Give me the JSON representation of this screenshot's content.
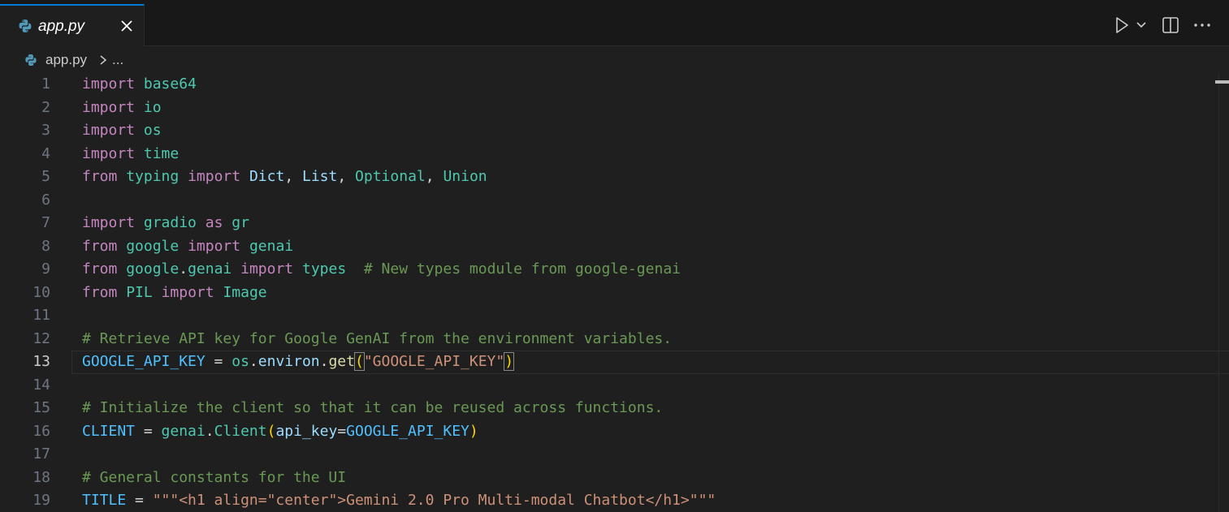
{
  "tab": {
    "label": "app.py",
    "icon": "python-icon"
  },
  "toolbar": {
    "run_icon": "run-icon",
    "run_dropdown_icon": "chevron-down-icon",
    "split_icon": "split-editor-icon",
    "more_icon": "ellipsis-icon"
  },
  "breadcrumb": {
    "file": "app.py",
    "more": "..."
  },
  "editor": {
    "current_line": 13,
    "lines": [
      {
        "n": "1"
      },
      {
        "n": "2"
      },
      {
        "n": "3"
      },
      {
        "n": "4"
      },
      {
        "n": "5"
      },
      {
        "n": "6"
      },
      {
        "n": "7"
      },
      {
        "n": "8"
      },
      {
        "n": "9"
      },
      {
        "n": "10"
      },
      {
        "n": "11"
      },
      {
        "n": "12"
      },
      {
        "n": "13"
      },
      {
        "n": "14"
      },
      {
        "n": "15"
      },
      {
        "n": "16"
      },
      {
        "n": "17"
      },
      {
        "n": "18"
      },
      {
        "n": "19"
      }
    ],
    "tokens": {
      "import": "import",
      "from": "from",
      "as": "as",
      "base64": "base64",
      "io": "io",
      "os": "os",
      "time": "time",
      "typing": "typing",
      "Dict": "Dict",
      "List": "List",
      "Optional": "Optional",
      "Union": "Union",
      "gradio": "gradio",
      "gr": "gr",
      "google": "google",
      "genai": "genai",
      "types": "types",
      "comment9": "# New types module from google-genai",
      "PIL": "PIL",
      "Image": "Image",
      "comment12": "# Retrieve API key for Google GenAI from the environment variables.",
      "GOOGLE_API_KEY": "GOOGLE_API_KEY",
      "environ": "environ",
      "get": "get",
      "str13": "\"GOOGLE_API_KEY\"",
      "comment15": "# Initialize the client so that it can be reused across functions.",
      "CLIENT": "CLIENT",
      "Client": "Client",
      "api_key": "api_key",
      "comment18": "# General constants for the UI",
      "TITLE": "TITLE",
      "str19": "\"\"\"<h1 align=\"center\">Gemini 2.0 Pro Multi-modal Chatbot</h1>\"\"\""
    }
  }
}
